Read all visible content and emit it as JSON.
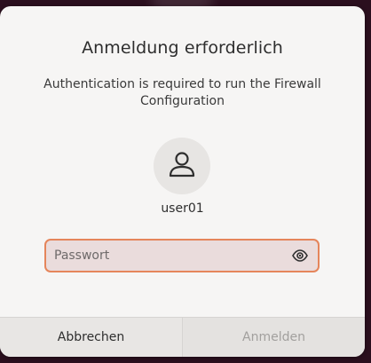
{
  "dialog": {
    "title": "Anmeldung erforderlich",
    "message": "Authentication is required to run the Firewall Configuration",
    "user": {
      "name": "user01",
      "avatar_icon": "user-avatar-icon"
    },
    "password": {
      "value": "",
      "placeholder": "Passwort",
      "reveal_icon": "eye-icon"
    },
    "buttons": {
      "cancel_label": "Abbrechen",
      "confirm_label": "Anmelden",
      "confirm_enabled": false
    }
  },
  "colors": {
    "accent": "#e5855b",
    "dialog_bg": "#f6f5f4",
    "backdrop": "#2b0f1e"
  }
}
